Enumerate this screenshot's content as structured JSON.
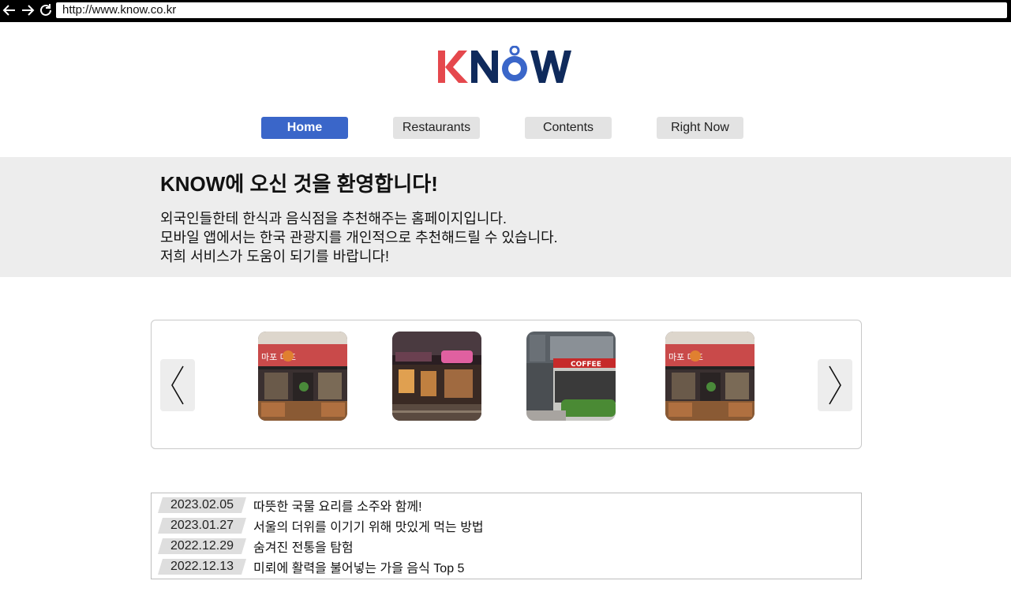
{
  "browser": {
    "url": "http://www.know.co.kr",
    "back_icon": "arrow-left-icon",
    "forward_icon": "arrow-right-icon",
    "reload_icon": "reload-icon"
  },
  "logo": {
    "text": "KNOW",
    "colors": {
      "k": "#e5484d",
      "now": "#0f2a5c"
    }
  },
  "nav": {
    "active_color": "#3a66c9",
    "tabs": [
      {
        "label": "Home",
        "active": true
      },
      {
        "label": "Restaurants",
        "active": false
      },
      {
        "label": "Contents",
        "active": false
      },
      {
        "label": "Right Now",
        "active": false
      }
    ]
  },
  "welcome": {
    "title": "KNOW에 오신 것을 환영합니다!",
    "lines": [
      "외국인들한테 한식과 음식점을 추천해주는 홈페이지입니다.",
      "모바일 앱에서는 한국 관광지를 개인적으로 추천해드릴 수 있습니다.",
      "저희 서비스가 도움이 되기를 바랍니다!"
    ]
  },
  "carousel": {
    "prev_icon": "chevron-left-icon",
    "next_icon": "chevron-right-icon",
    "images": [
      {
        "name": "mapo-restaurant-photo",
        "sign": "마포 대포"
      },
      {
        "name": "pub-night-photo",
        "sign": ""
      },
      {
        "name": "coffee-shop-photo",
        "sign": "COFFEE"
      },
      {
        "name": "mapo-restaurant-photo-2",
        "sign": "마포 대포"
      }
    ]
  },
  "news": [
    {
      "date": "2023.02.05",
      "title": "따뜻한 국물 요리를 소주와 함께!"
    },
    {
      "date": "2023.01.27",
      "title": "서울의 더위를 이기기 위해 맛있게 먹는 방법"
    },
    {
      "date": "2022.12.29",
      "title": "숨겨진 전통을 탐험"
    },
    {
      "date": "2022.12.13",
      "title": "미뢰에 활력을 불어넣는 가을 음식 Top 5"
    }
  ]
}
